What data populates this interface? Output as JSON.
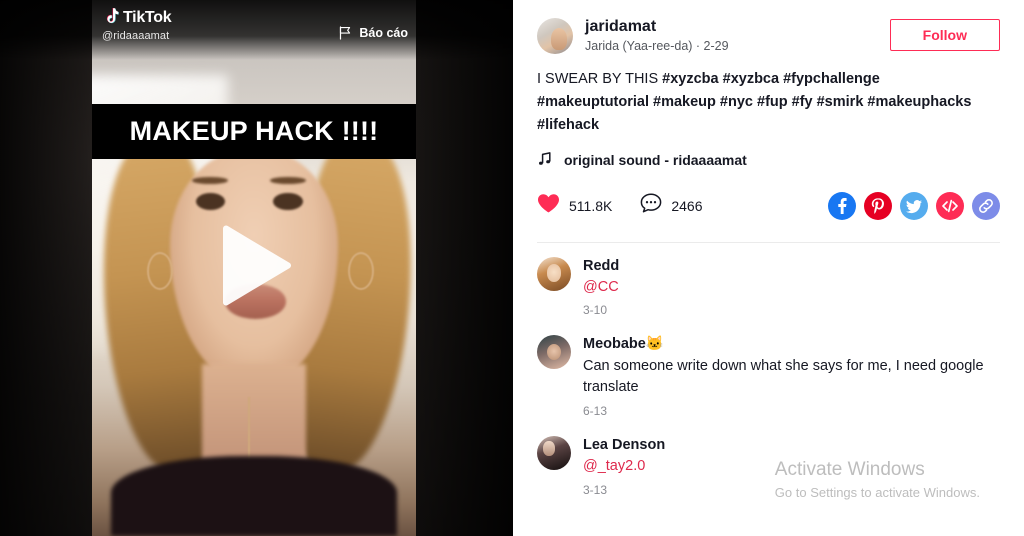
{
  "video": {
    "brand_name": "TikTok",
    "brand_icon": "tiktok-note-icon",
    "watermark_handle": "@ridaaaamat",
    "report_label": "Báo cáo",
    "report_icon": "flag-icon",
    "overlay_text": "MAKEUP HACK !!!!",
    "play_icon": "play-icon"
  },
  "post": {
    "author_username": "jaridamat",
    "author_display": "Jarida (Yaa-ree-da) · 2-29",
    "follow_label": "Follow",
    "caption_plain": "I SWEAR BY THIS ",
    "caption_tags_line1": "#xyzcba #xyzbca #fypchallenge",
    "caption_tags_line2": "#makeuptutorial #makeup #nyc #fup #fy #smirk #makeuphacks",
    "caption_tags_line3": "#lifehack",
    "music_icon": "music-note-icon",
    "music_label": "original sound - ridaaaamat",
    "like_icon": "heart-icon",
    "like_count": "511.8K",
    "comment_icon": "comment-bubble-icon",
    "comment_count": "2466",
    "share": [
      {
        "name": "facebook-share-icon",
        "glyph": "f",
        "color": "#1877F2"
      },
      {
        "name": "pinterest-share-icon",
        "glyph": "P",
        "color": "#E60023"
      },
      {
        "name": "twitter-share-icon",
        "glyph": "t",
        "color": "#55ACEE"
      },
      {
        "name": "embed-code-icon",
        "glyph": "</>",
        "color": "#FE2C55"
      },
      {
        "name": "copy-link-icon",
        "glyph": "link",
        "color": "#7D8CE8"
      }
    ]
  },
  "comments": [
    {
      "name": "Redd",
      "text": "@CC",
      "is_mention": true,
      "time": "3-10"
    },
    {
      "name": "Meobabe🐱",
      "text": "Can someone write down what she says for me, I need google translate",
      "is_mention": false,
      "time": "6-13"
    },
    {
      "name": "Lea Denson",
      "text": "@_tay2.0",
      "is_mention": true,
      "time": "3-13"
    }
  ],
  "watermark": {
    "title": "Activate Windows",
    "subtitle": "Go to Settings to activate Windows."
  },
  "colors": {
    "accent": "#FE2C55",
    "mention": "#DE294C",
    "text": "#161823",
    "muted": "#8A8B91"
  }
}
